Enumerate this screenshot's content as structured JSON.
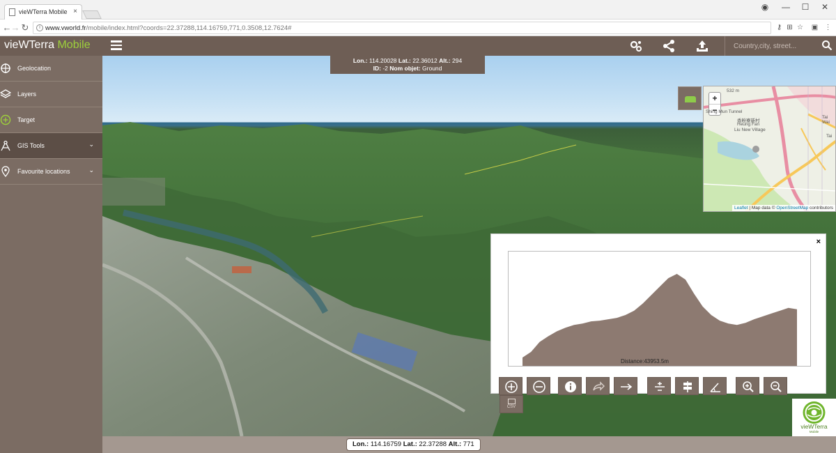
{
  "browser": {
    "tab_title": "vieWTerra Mobile",
    "tab_close": "×",
    "url_host": "www.vworld.fr",
    "url_path": "/mobile/index.html?coords=22.37288,114.16759,771,0.3508,12.7624#",
    "window_controls": {
      "account": "◉",
      "minimize": "—",
      "maximize": "☐",
      "close": "✕"
    },
    "nav": {
      "back": "←",
      "forward": "→",
      "reload": "↻"
    },
    "extension_icons": {
      "key": "⚷",
      "translate": "⊞",
      "star": "☆",
      "cast": "▣",
      "menu": "⋮"
    }
  },
  "app": {
    "logo_main": "vieWTerra",
    "logo_accent": "Mobile",
    "search": {
      "placeholder": "Country,city, street..."
    },
    "header_icons": [
      "settings-icon",
      "share-icon",
      "upload-icon"
    ]
  },
  "sidebar": {
    "items": [
      {
        "label": "Geolocation",
        "icon": "crosshair-icon",
        "has_chevron": false
      },
      {
        "label": "Layers",
        "icon": "layers-icon",
        "has_chevron": false
      },
      {
        "label": "Target",
        "icon": "target-icon",
        "has_chevron": false
      },
      {
        "label": "GIS Tools",
        "icon": "compass-icon",
        "has_chevron": true,
        "active": true
      },
      {
        "label": "Favourite locations",
        "icon": "location-pin-icon",
        "has_chevron": true
      }
    ],
    "chevron": "⌄"
  },
  "coord_top": {
    "lon_label": "Lon.:",
    "lon": "114.20028",
    "lat_label": "Lat.:",
    "lat": "22.36012",
    "alt_label": "Alt.:",
    "alt": "294",
    "id_label": "ID:",
    "id": "-2",
    "nom_label": "Nom objet:",
    "nom": "Ground"
  },
  "minimap": {
    "zoom_in": "+",
    "zoom_out": "−",
    "elevation_label": "532 m",
    "tunnel_label": "Shing Mun Tunnel",
    "village_cn": "香粉寮新村",
    "village_1": "Heung Fan",
    "village_2": "Liu New Village",
    "tai_label": "Tai",
    "taiwai_label": "Tai Wai",
    "attribution_leaflet": "Leaflet",
    "attribution_sep": " | Map data © ",
    "attribution_osm": "OpenStreetMap",
    "attribution_tail": " contributors",
    "colors": {
      "road_major": "#e88ea3",
      "road_minor": "#f7c85a",
      "water": "#aad3df",
      "park": "#cde8b4"
    }
  },
  "profile": {
    "close": "×",
    "distance_label": "Distance:43953.5m",
    "fill_color": "#8d7a71",
    "elevation_profile": [
      0,
      8,
      22,
      30,
      37,
      42,
      46,
      48,
      51,
      52,
      54,
      56,
      60,
      66,
      76,
      88,
      100,
      112,
      118,
      110,
      90,
      72,
      60,
      52,
      48,
      46,
      49,
      54,
      58,
      62,
      66,
      70,
      68
    ]
  },
  "tools": [
    {
      "name": "zoom-in-profile-button",
      "icon": "plus-circle-icon"
    },
    {
      "name": "zoom-out-profile-button",
      "icon": "minus-circle-icon"
    },
    {
      "name": "info-button",
      "icon": "info-icon"
    },
    {
      "name": "redo-button",
      "icon": "share-arrow-icon"
    },
    {
      "name": "horizontal-measure-button",
      "icon": "arrow-right-icon"
    },
    {
      "name": "height-measure-button",
      "icon": "plus-minus-icon"
    },
    {
      "name": "signpost-button",
      "icon": "signpost-icon"
    },
    {
      "name": "angle-button",
      "icon": "angle-icon"
    },
    {
      "name": "magnify-in-button",
      "icon": "magnifier-plus-icon"
    },
    {
      "name": "magnify-out-button",
      "icon": "magnifier-minus-icon"
    }
  ],
  "csv": {
    "label": "CSV"
  },
  "brand": {
    "name": "vieWTerra",
    "sub": "Mobile"
  },
  "coord_bottom": {
    "lon_label": "Lon.:",
    "lon": "114.16759",
    "lat_label": "Lat.:",
    "lat": "22.37288",
    "alt_label": "Alt.:",
    "alt": "771"
  }
}
